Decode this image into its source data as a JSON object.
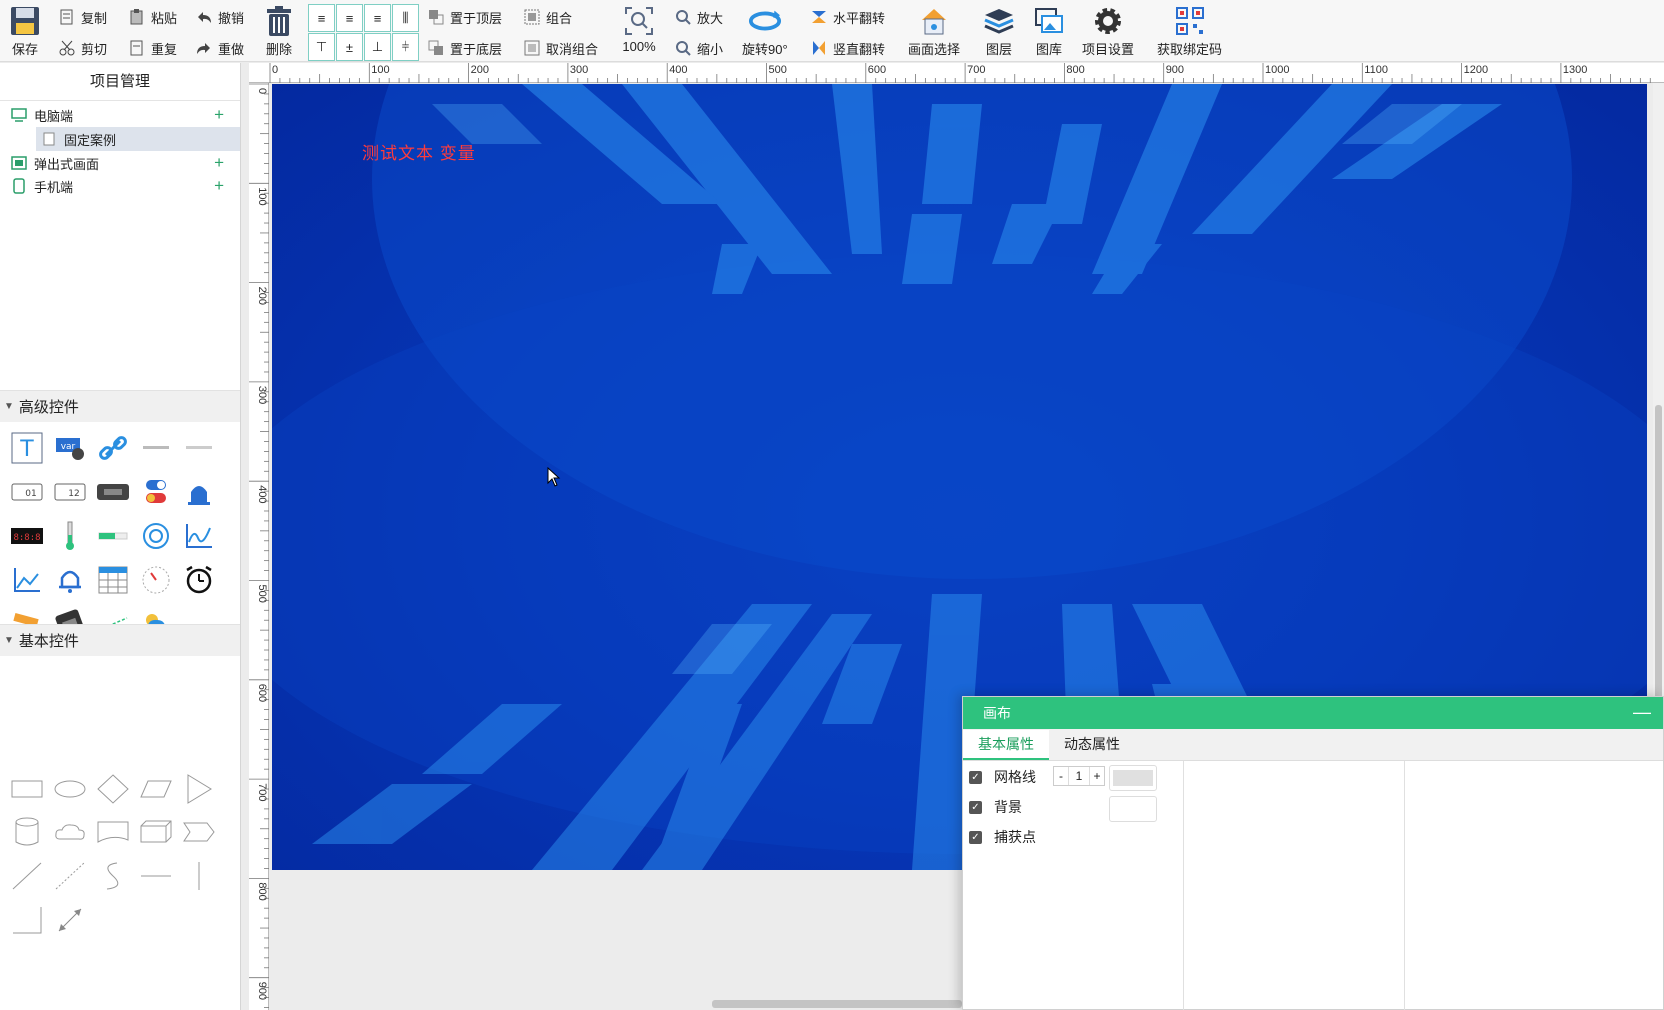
{
  "toolbar": {
    "save": "保存",
    "copy": "复制",
    "paste": "粘贴",
    "undo": "撤销",
    "cut": "剪切",
    "duplicate": "重复",
    "redo": "重做",
    "delete": "删除",
    "bring_top": "置于顶层",
    "send_bottom": "置于底层",
    "group": "组合",
    "ungroup": "取消组合",
    "zoom_level": "100%",
    "zoom_in": "放大",
    "zoom_out": "缩小",
    "rotate": "旋转90°",
    "flip_h": "水平翻转",
    "flip_v": "竖直翻转",
    "screen_select": "画面选择",
    "layers": "图层",
    "gallery": "图库",
    "project_settings": "项目设置",
    "get_binding_code": "获取绑定码"
  },
  "left_panel": {
    "title": "项目管理",
    "tree": [
      {
        "label": "电脑端",
        "icon": "monitor-icon",
        "has_add": true
      },
      {
        "label": "固定案例",
        "icon": "page-icon",
        "has_add": false,
        "selected": true
      },
      {
        "label": "弹出式画面",
        "icon": "popup-icon",
        "has_add": true
      },
      {
        "label": "手机端",
        "icon": "phone-icon",
        "has_add": true
      }
    ],
    "advanced_title": "高级控件",
    "basic_title": "基本控件"
  },
  "ruler": {
    "h_labels": [
      "0",
      "100",
      "200",
      "300",
      "400",
      "500",
      "600",
      "700",
      "800",
      "900",
      "1000",
      "1100",
      "1200",
      "1300"
    ],
    "v_labels": [
      "0",
      "100",
      "200",
      "300",
      "400",
      "500",
      "600",
      "700",
      "800",
      "900"
    ]
  },
  "canvas": {
    "label": "测试文本  变量",
    "label_color": "#ff3b3b",
    "bg_color": "#0636b6"
  },
  "props": {
    "title": "画布",
    "tabs": [
      "基本属性",
      "动态属性"
    ],
    "active_tab": 0,
    "rows": [
      {
        "label": "网格线",
        "checked": true
      },
      {
        "label": "背景",
        "checked": true
      },
      {
        "label": "捕获点",
        "checked": true
      }
    ],
    "grid_size": "1",
    "grid_color": "#e0e0e0",
    "bg_color": "#ffffff",
    "accent": "#2ec27e"
  }
}
